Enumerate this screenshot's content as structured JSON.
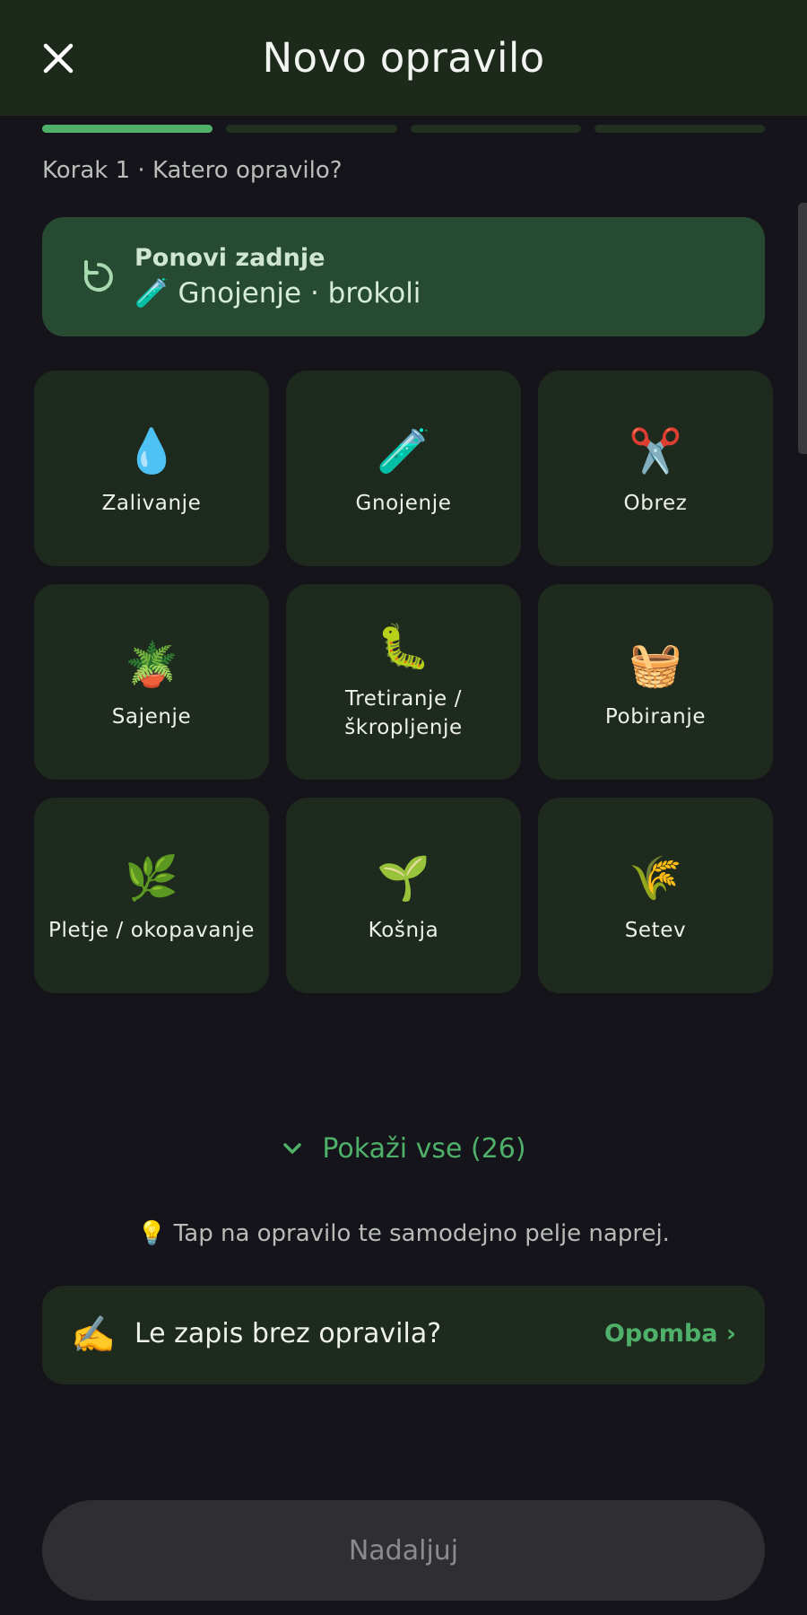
{
  "header": {
    "title": "Novo opravilo",
    "close_icon": "close-icon"
  },
  "progress": {
    "steps": 4,
    "current": 1
  },
  "step_label": "Korak 1 · Katero opravilo?",
  "repeat_last": {
    "title": "Ponovi zadnje",
    "subtitle": "🧪 Gnojenje · brokoli",
    "icon": "repeat-icon"
  },
  "tasks": [
    {
      "emoji": "💧",
      "label": "Zalivanje"
    },
    {
      "emoji": "🧪",
      "label": "Gnojenje"
    },
    {
      "emoji": "✂️",
      "label": "Obrez"
    },
    {
      "emoji": "🪴",
      "label": "Sajenje"
    },
    {
      "emoji": "🐛",
      "label": "Tretiranje / škropljenje"
    },
    {
      "emoji": "🧺",
      "label": "Pobiranje"
    },
    {
      "emoji": "🌿",
      "label": "Pletje / okopavanje"
    },
    {
      "emoji": "🌱",
      "label": "Košnja"
    },
    {
      "emoji": "🌾",
      "label": "Setev"
    }
  ],
  "show_all": {
    "label": "Pokaži vse (26)",
    "icon": "chevron-down-icon"
  },
  "hint": "💡 Tap na opravilo te samodejno pelje naprej.",
  "note_row": {
    "emoji": "✍️",
    "text": "Le zapis brez opravila?",
    "link": "Opomba ›"
  },
  "continue_button": "Nadaljuj",
  "colors": {
    "header_bg": "#1d2a1b",
    "accent": "#4fb06a",
    "tile_bg": "#1d2a1d",
    "repeat_bg": "#264a32",
    "page_bg": "#15141a"
  }
}
